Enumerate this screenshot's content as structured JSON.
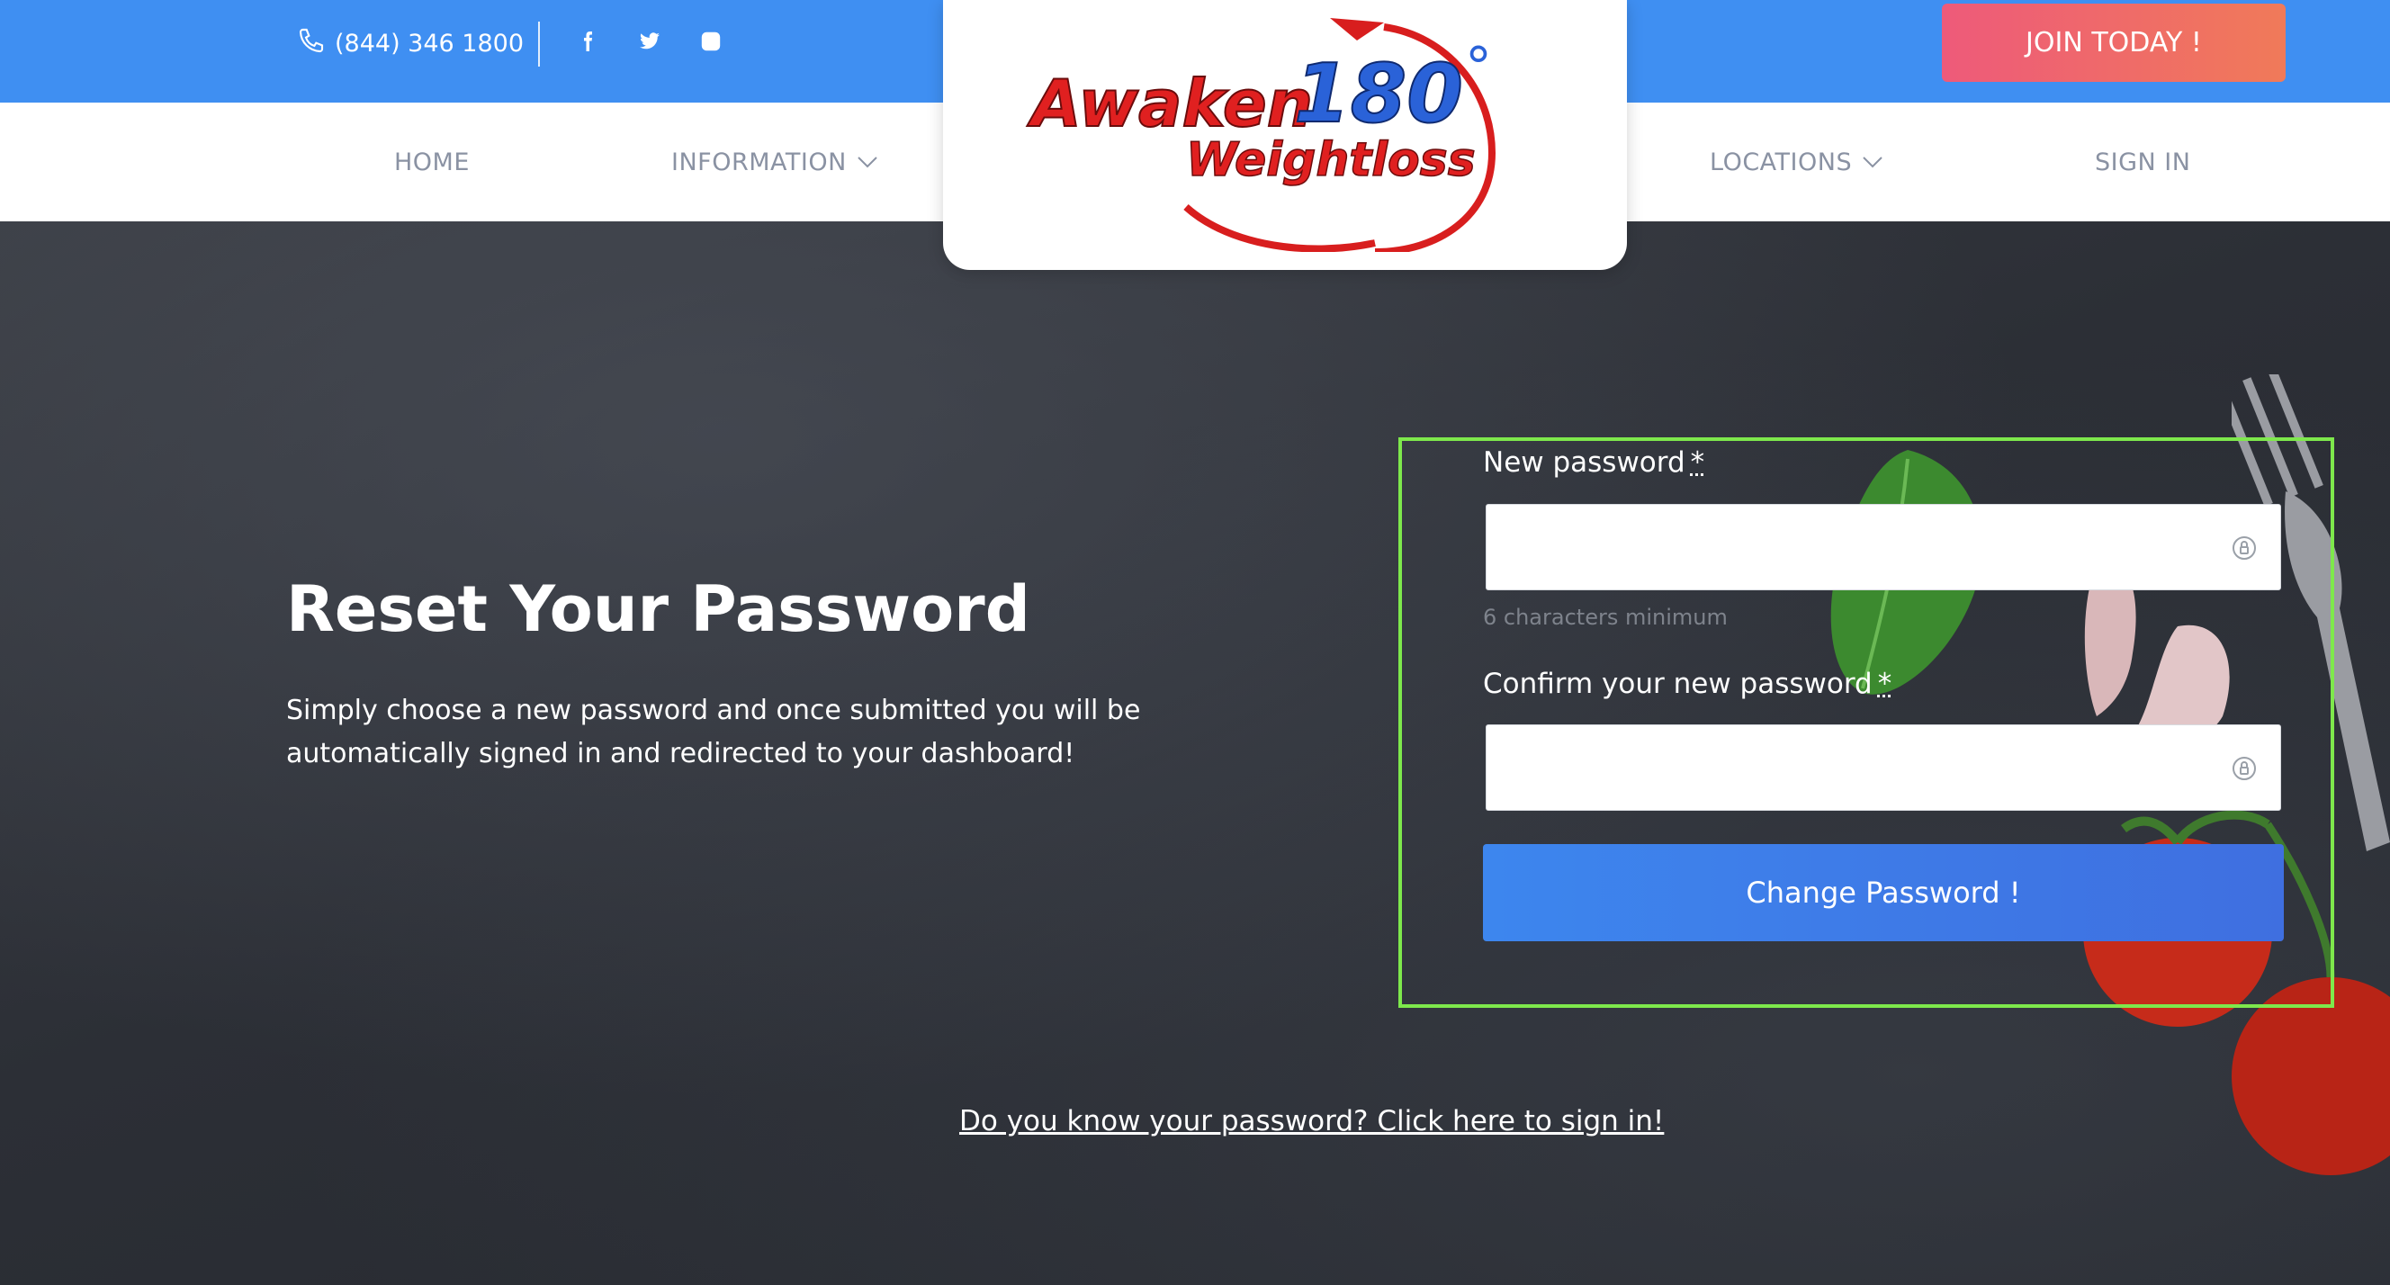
{
  "header": {
    "phone": "(844) 346 1800",
    "social": [
      "facebook-icon",
      "twitter-icon",
      "instagram-icon"
    ],
    "join_label": "JOIN TODAY !"
  },
  "nav": {
    "home": "HOME",
    "information": "INFORMATION",
    "locations": "LOCATIONS",
    "signin": "SIGN IN"
  },
  "logo": {
    "line1": "Awaken",
    "number": "180",
    "degree": "°",
    "line2": "Weightloss"
  },
  "hero": {
    "title": "Reset Your Password",
    "description": "Simply choose a new password and once submitted you will be automatically signed in and redirected to your dashboard!"
  },
  "form": {
    "new_password_label": "New password",
    "required_mark": "*",
    "new_password_value": "",
    "hint": "6 characters minimum",
    "confirm_label": "Confirm your new password",
    "confirm_value": "",
    "submit_label": "Change Password !"
  },
  "footer_link": "Do you know your password? Click here to sign in!",
  "colors": {
    "topbar": "#3f8ff2",
    "join_gradient_start": "#ee5a7a",
    "join_gradient_end": "#f07a59",
    "submit": "#3d86ee",
    "highlight_border": "#7ee84c",
    "logo_red": "#e02020",
    "nav_text": "#8a92a3"
  }
}
